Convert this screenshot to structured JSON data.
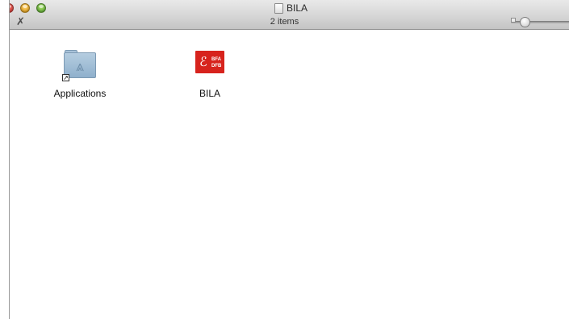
{
  "window": {
    "title": "BILA",
    "status": "2 items"
  },
  "colors": {
    "close": "#e0443e",
    "minimize": "#f5b22c",
    "zoom": "#7bc24a",
    "bila_red": "#d7231d",
    "folder_blue": "#9cb9d3"
  },
  "icons": {
    "toolbar_tool": "arrange-icon",
    "title_doc": "disk-image-icon"
  },
  "items": [
    {
      "label": "Applications",
      "icon": "applications-folder-alias-icon"
    },
    {
      "label": "BILA",
      "icon": "bila-app-icon",
      "logo_text_top": "BFA",
      "logo_text_bottom": "DFB"
    }
  ],
  "zoom_slider": {
    "value": 0.15
  }
}
